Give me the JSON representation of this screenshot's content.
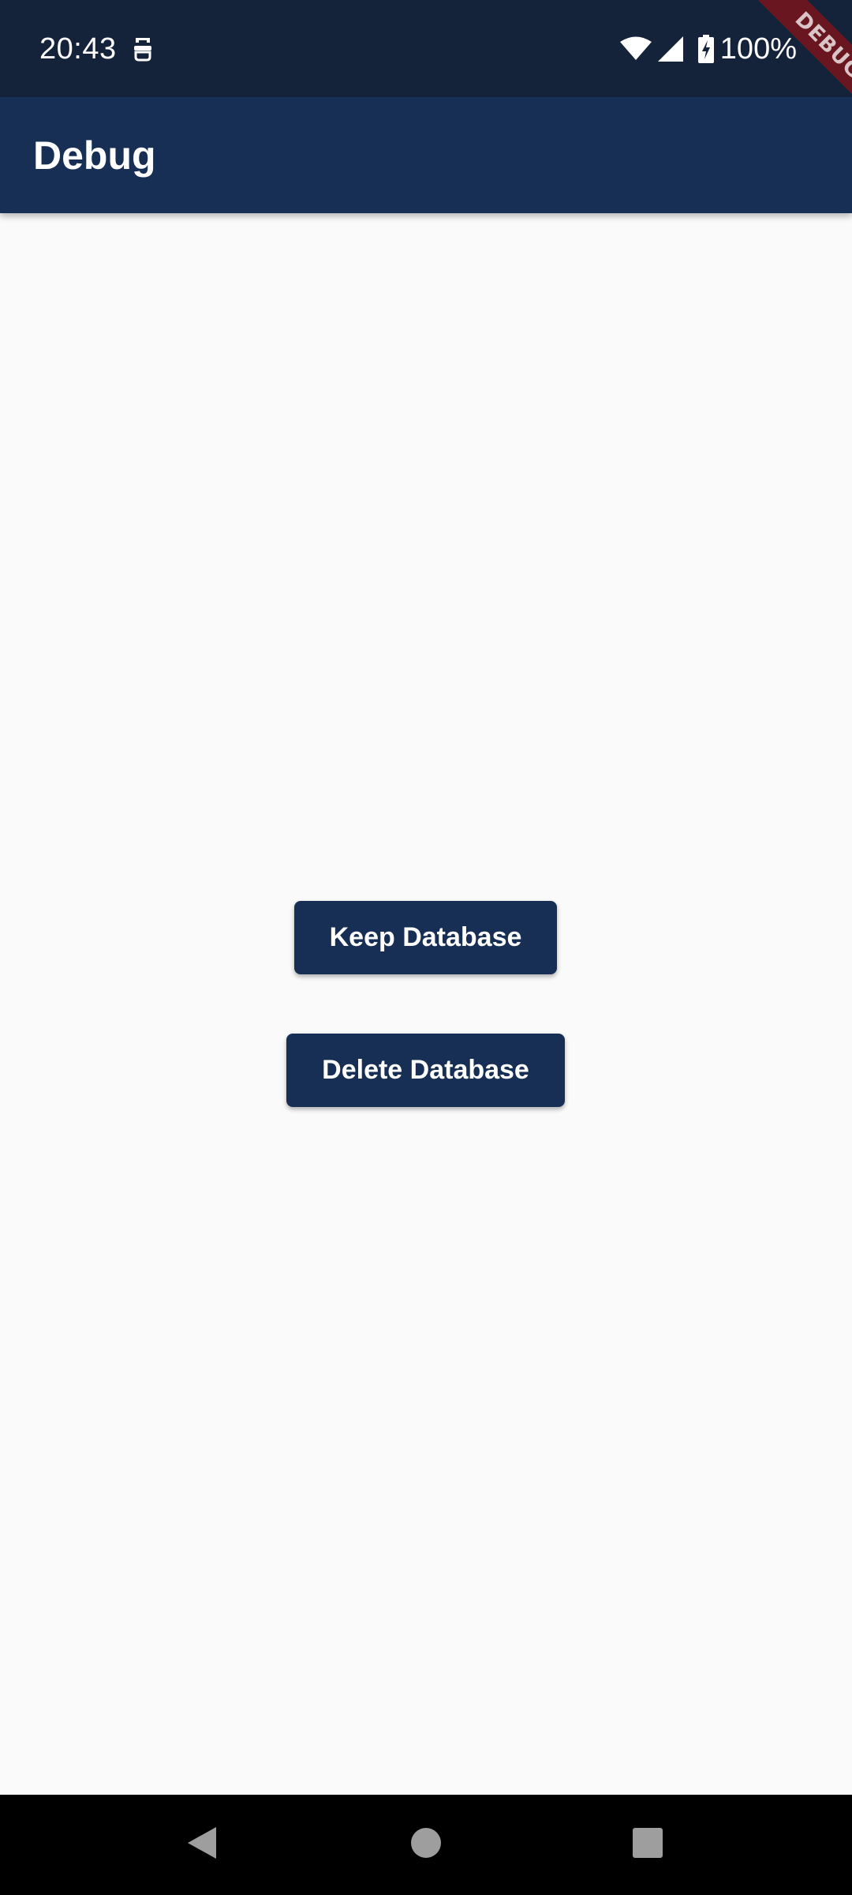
{
  "status_bar": {
    "time": "20:43",
    "battery_percent": "100%",
    "icons": [
      "notification-icon",
      "wifi-icon",
      "signal-icon",
      "battery-charging-icon"
    ]
  },
  "app_bar": {
    "title": "Debug"
  },
  "debug_banner": {
    "label": "DEBUG"
  },
  "main": {
    "keep_button_label": "Keep Database",
    "delete_button_label": "Delete Database"
  },
  "nav_bar": {
    "icons": [
      "back-icon",
      "home-icon",
      "recents-icon"
    ]
  },
  "colors": {
    "status_bar": "#14223a",
    "app_bar": "#182f55",
    "button": "#182f55",
    "background": "#fafafa",
    "debug_banner": "#78141c"
  }
}
